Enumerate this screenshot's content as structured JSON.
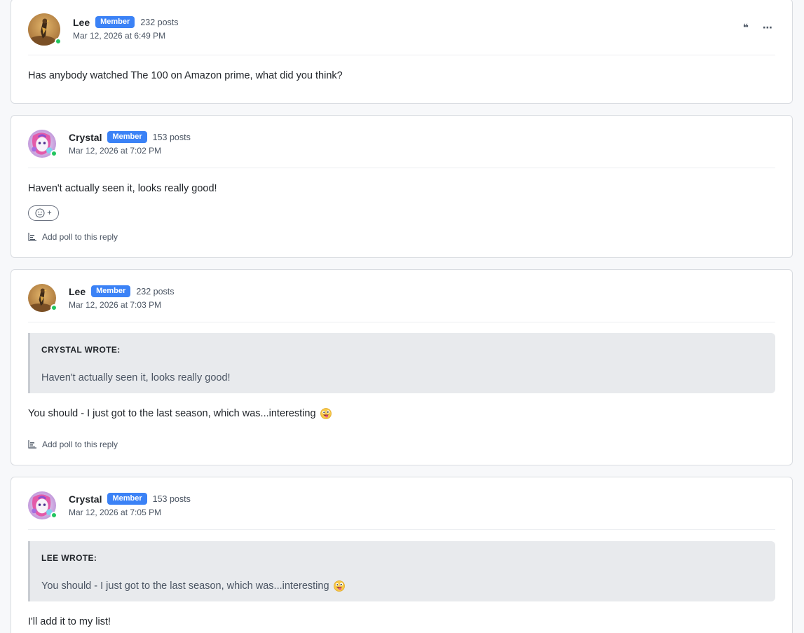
{
  "posts": [
    {
      "author": "Lee",
      "badge": "Member",
      "posts_count": "232 posts",
      "date": "Mar 12, 2026 at 6:49 PM",
      "online": true,
      "body": "Has anybody watched The 100 on Amazon prime, what did you think?",
      "actions": {
        "quote_icon": "quote-icon",
        "more_icon": "more-options-icon",
        "quote_glyph": "❝",
        "more_glyph": "⋯"
      }
    },
    {
      "author": "Crystal",
      "badge": "Member",
      "posts_count": "153 posts",
      "date": "Mar 12, 2026 at 7:02 PM",
      "online": true,
      "body": "Haven't actually seen it, looks really good!",
      "reaction_plus": "+",
      "poll_label": "Add poll to this reply"
    },
    {
      "author": "Lee",
      "badge": "Member",
      "posts_count": "232 posts",
      "date": "Mar 12, 2026 at 7:03 PM",
      "online": true,
      "quote_title": "CRYSTAL WROTE:",
      "quote_text": "Haven't actually seen it, looks really good!",
      "body": "You should - I just got to the last season, which was...interesting",
      "poll_label": "Add poll to this reply"
    },
    {
      "author": "Crystal",
      "badge": "Member",
      "posts_count": "153 posts",
      "date": "Mar 12, 2026 at 7:05 PM",
      "online": true,
      "quote_title": "LEE WROTE:",
      "quote_text": "You should - I just got to the last season, which was...interesting",
      "body": "I'll add it to my list!"
    }
  ],
  "colors": {
    "badge": "#3b82f6",
    "online": "#22c55e",
    "quote_bg": "#e8eaed"
  }
}
